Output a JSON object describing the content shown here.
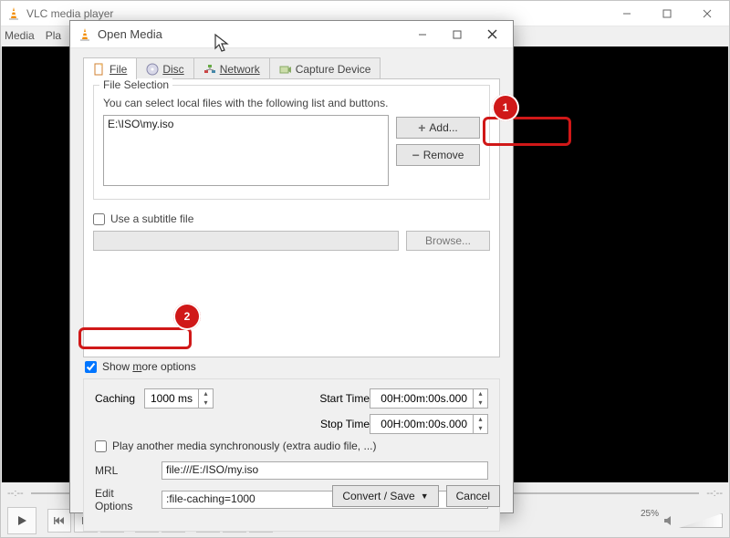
{
  "main": {
    "title": "VLC media player",
    "menu": {
      "media": "Media",
      "playback": "Pla"
    },
    "time_left": "--:--",
    "time_right": "--:--",
    "volume_pct": "25%"
  },
  "dialog": {
    "title": "Open Media",
    "tabs": {
      "file": "File",
      "disc": "Disc",
      "network": "Network",
      "capture": "Capture Device"
    },
    "file_selection": {
      "legend": "File Selection",
      "description": "You can select local files with the following list and buttons.",
      "file_entry": "E:\\ISO\\my.iso",
      "add_label": "Add...",
      "remove_label": "Remove"
    },
    "subtitle": {
      "checkbox_label": "Use a subtitle file",
      "browse_label": "Browse..."
    },
    "show_more_label": "Show more options",
    "advanced": {
      "caching_label": "Caching",
      "caching_value": "1000 ms",
      "start_time_label": "Start Time",
      "start_time_value": "00H:00m:00s.000",
      "stop_time_label": "Stop Time",
      "stop_time_value": "00H:00m:00s.000",
      "sync_label": "Play another media synchronously (extra audio file, ...)",
      "mrl_label": "MRL",
      "mrl_value": "file:///E:/ISO/my.iso",
      "edit_options_label": "Edit Options",
      "edit_options_value": ":file-caching=1000"
    },
    "buttons": {
      "convert": "Convert / Save",
      "cancel": "Cancel"
    }
  },
  "annotations": {
    "one": "1",
    "two": "2"
  }
}
